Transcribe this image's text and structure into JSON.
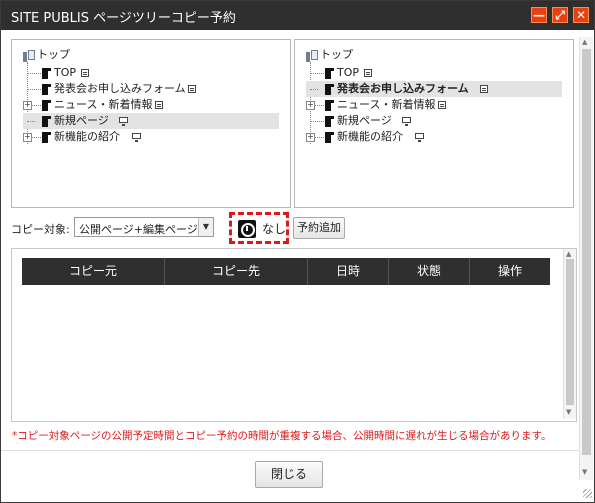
{
  "window": {
    "title": "SITE PUBLIS ページツリーコピー予約",
    "controls": {
      "minimize": "—",
      "maximize": "⤢",
      "close": "✕"
    },
    "accent": "#e8410f"
  },
  "tree_left": {
    "root": "トップ",
    "nodes": [
      {
        "label": "TOP",
        "icon": "page-icon",
        "badge": "mini-doc-icon"
      },
      {
        "label": "発表会お申し込みフォーム",
        "icon": "page-icon",
        "badge": "mini-doc-icon"
      },
      {
        "label": "ニュース・新着情報",
        "icon": "page-icon",
        "badge": "mini-doc-icon",
        "expandable": true
      },
      {
        "label": "新規ページ",
        "icon": "page-icon",
        "badge": "monitor-icon",
        "selected": true
      },
      {
        "label": "新機能の紹介",
        "icon": "page-icon",
        "badge": "monitor-icon",
        "expandable": true
      }
    ]
  },
  "tree_right": {
    "root": "トップ",
    "nodes": [
      {
        "label": "TOP",
        "icon": "page-icon",
        "badge": "mini-doc-icon"
      },
      {
        "label": "発表会お申し込みフォーム",
        "icon": "page-icon",
        "badge": "mini-doc-icon",
        "selected": true
      },
      {
        "label": "ニュース・新着情報",
        "icon": "page-icon",
        "badge": "mini-doc-icon",
        "expandable": true
      },
      {
        "label": "新規ページ",
        "icon": "page-icon",
        "badge": "monitor-icon"
      },
      {
        "label": "新機能の紹介",
        "icon": "page-icon",
        "badge": "monitor-icon",
        "expandable": true
      }
    ]
  },
  "copy_target": {
    "label": "コピー対象:",
    "selected": "公開ページ+編集ページ"
  },
  "schedule": {
    "value": "なし",
    "add_button": "予約追加",
    "highlight_color": "#e0181b"
  },
  "table": {
    "headers": [
      "コピー元",
      "コピー先",
      "日時",
      "状態",
      "操作"
    ],
    "rows": []
  },
  "warning": "*コピー対象ページの公開予定時間とコピー予約の時間が重複する場合、公開時間に遅れが生じる場合があります。",
  "footer": {
    "close_button": "閉じる"
  }
}
